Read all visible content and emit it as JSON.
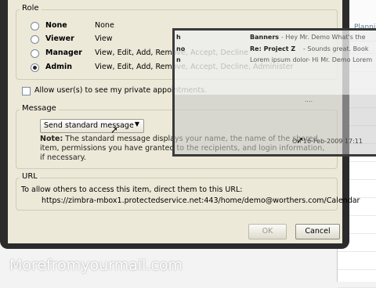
{
  "background": {
    "tab_label": "Planni"
  },
  "dialog": {
    "role_legend": "Role",
    "roles": [
      {
        "name": "None",
        "permissions": "None",
        "selected": false
      },
      {
        "name": "Viewer",
        "permissions": "View",
        "selected": false
      },
      {
        "name": "Manager",
        "permissions": "View, Edit, Add, Remove, Accept, Decline",
        "selected": false
      },
      {
        "name": "Admin",
        "permissions": "View, Edit, Add, Remove, Accept, Decline, Administer",
        "selected": true
      }
    ],
    "private_checkbox_label": "Allow user(s) to see my private appointments.",
    "private_checked": false,
    "message_legend": "Message",
    "message_select_value": "Send standard message",
    "note_label": "Note:",
    "note_text": "The standard message displays your name, the name of the shared item, permissions you have granted to the recipients, and login information, if necessary.",
    "url_legend": "URL",
    "url_intro": "To allow others to access this item, direct them to this URL:",
    "url_value": "https://zimbra-mbox1.protectedservice.net:443/home/demo@worthers.com/Calendar",
    "ok_label": "OK",
    "cancel_label": "Cancel"
  },
  "preview": {
    "rows": [
      {
        "from": "h",
        "subject": "Banners",
        "snippet": "- Hey Mr. Demo What's the"
      },
      {
        "from": "no",
        "subject": "Re: Project Z",
        "snippet": "- Sounds great. Book"
      },
      {
        "from": "n",
        "subject": "Lorem ipsum dolor",
        "snippet": "- Hi Mr. Demo Lorem"
      }
    ],
    "divider": "....",
    "date_text": "On 16-Feb-2009 17:11"
  },
  "watermark": "Morefromyourmail.com"
}
